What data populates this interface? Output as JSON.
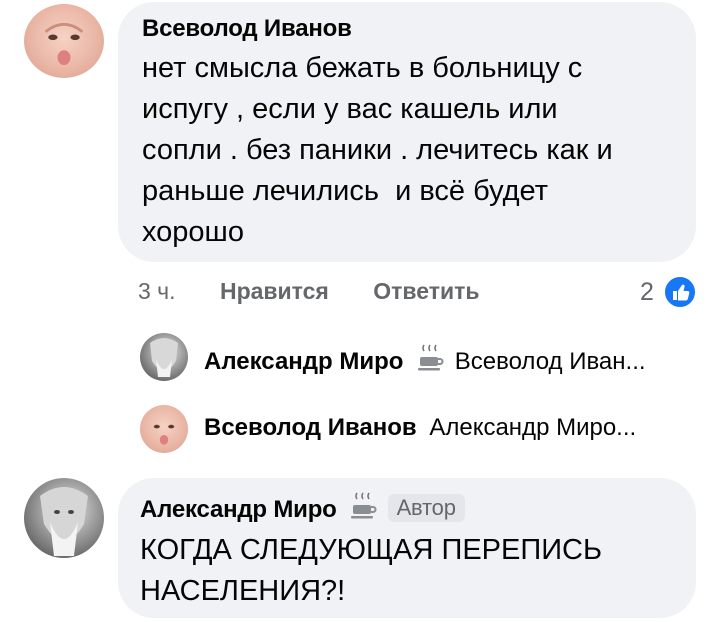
{
  "comment1": {
    "author": "Всеволод Иванов",
    "lines": [
      "нет смысла бежать в больницу с",
      "испугу , если у вас кашель или",
      "сопли . без паники . лечитесь как и",
      "раньше лечились  и всё будет",
      "хорошо"
    ],
    "time": "3 ч.",
    "like_label": "Нравится",
    "reply_label": "Ответить",
    "like_count": "2"
  },
  "replies": [
    {
      "name": "Александр Миро",
      "text": "Всеволод Иван..."
    },
    {
      "name": "Всеволод Иванов",
      "text": "Александр Миро..."
    }
  ],
  "comment2": {
    "author": "Александр Миро",
    "badge": "Автор",
    "lines": [
      "КОГДА СЛЕДУЮЩАЯ ПЕРЕПИСЬ",
      "НАСЕЛЕНИЯ?!"
    ]
  },
  "icons": {
    "like": "thumbs-up-icon",
    "cup": "coffee-cup-icon"
  },
  "colors": {
    "bubble": "#f0f2f5",
    "like_blue": "#1877f2",
    "muted": "#65676b"
  }
}
